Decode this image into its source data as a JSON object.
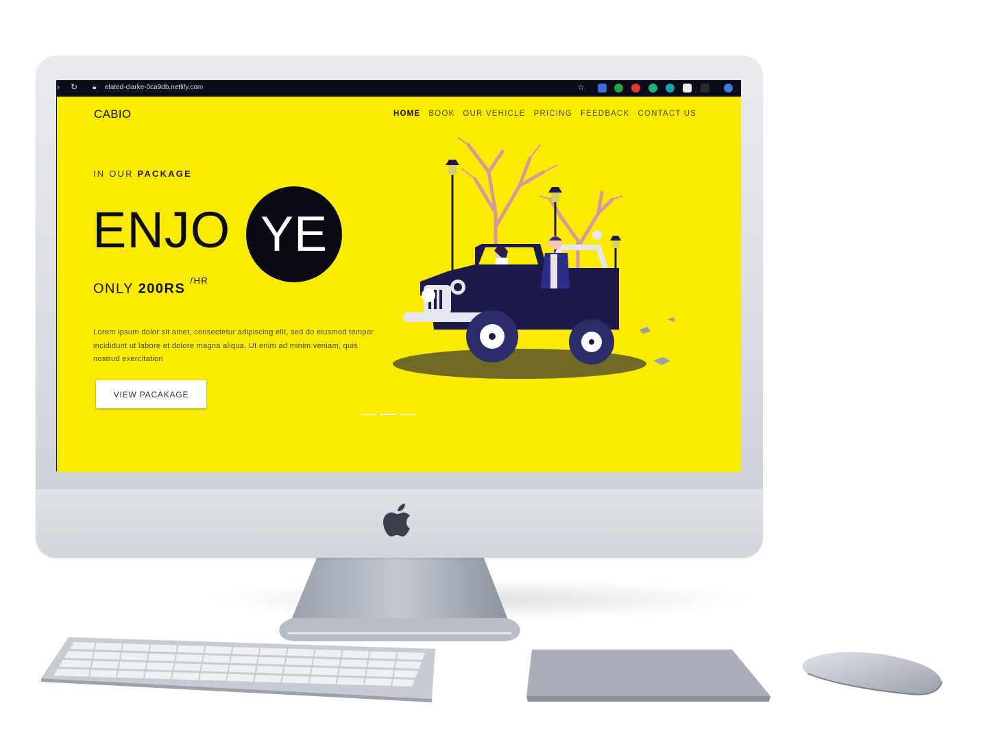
{
  "browser": {
    "url": "elated-clarke-0ca9db.netlify.com",
    "icons": [
      "forward-icon",
      "reload-icon",
      "lock-icon",
      "star-icon",
      "translate-icon",
      "extension-icon",
      "extension-icon",
      "grammarly-icon",
      "extension-icon",
      "extension-icon",
      "profile-icon"
    ]
  },
  "site": {
    "brand": "CABIO",
    "nav": [
      {
        "label": "HOME",
        "active": true
      },
      {
        "label": "BOOK",
        "active": false
      },
      {
        "label": "OUR VEHICLE",
        "active": false
      },
      {
        "label": "PRICING",
        "active": false
      },
      {
        "label": "FEEDBACK",
        "active": false
      },
      {
        "label": "CONTACT US",
        "active": false
      }
    ],
    "eyebrow_prefix": "IN OUR ",
    "eyebrow_strong": "PACKAGE",
    "headline": "ENJO",
    "headline_circle": "YE",
    "price_prefix": "ONLY ",
    "price_value": "200RS",
    "price_unit": "/HR",
    "paragraph": "Lorem ipsum dolor sit amet, consectetur adipiscing elit, sed do eiusmod tempor incididunt ut labore et dolore magna aliqua. Ut enim ad minim veniam, quis nostrud exercitation",
    "cta_label": "VIEW PACAKAGE",
    "slider_active_index": 1
  },
  "colors": {
    "accent_yellow": "#fbeb00",
    "dark": "#0a0a14",
    "jeep_navy": "#1b1a4a",
    "browser_bar": "#0c0d1b"
  }
}
